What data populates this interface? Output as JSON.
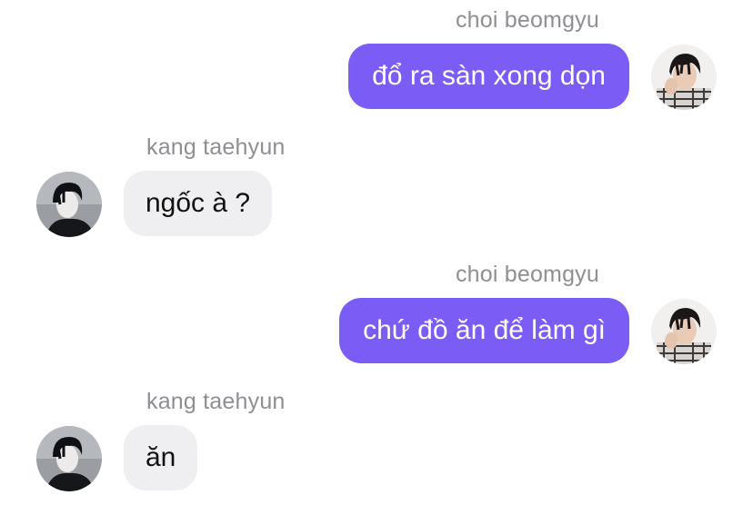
{
  "messages": [
    {
      "sender": "choi beomgyu",
      "text": "đổ ra sàn xong dọn",
      "direction": "outgoing",
      "avatar": "beomgyu-avatar"
    },
    {
      "sender": "kang taehyun",
      "text": "ngốc à ?",
      "direction": "incoming",
      "avatar": "taehyun-avatar"
    },
    {
      "sender": "choi beomgyu",
      "text": "chứ đồ ăn để làm gì",
      "direction": "outgoing",
      "avatar": "beomgyu-avatar"
    },
    {
      "sender": "kang taehyun",
      "text": "ăn",
      "direction": "incoming",
      "avatar": "taehyun-avatar"
    }
  ],
  "colors": {
    "outgoing_bubble": "#7b5cf5",
    "incoming_bubble": "#efeff1",
    "sender_name": "#8e8e93"
  }
}
